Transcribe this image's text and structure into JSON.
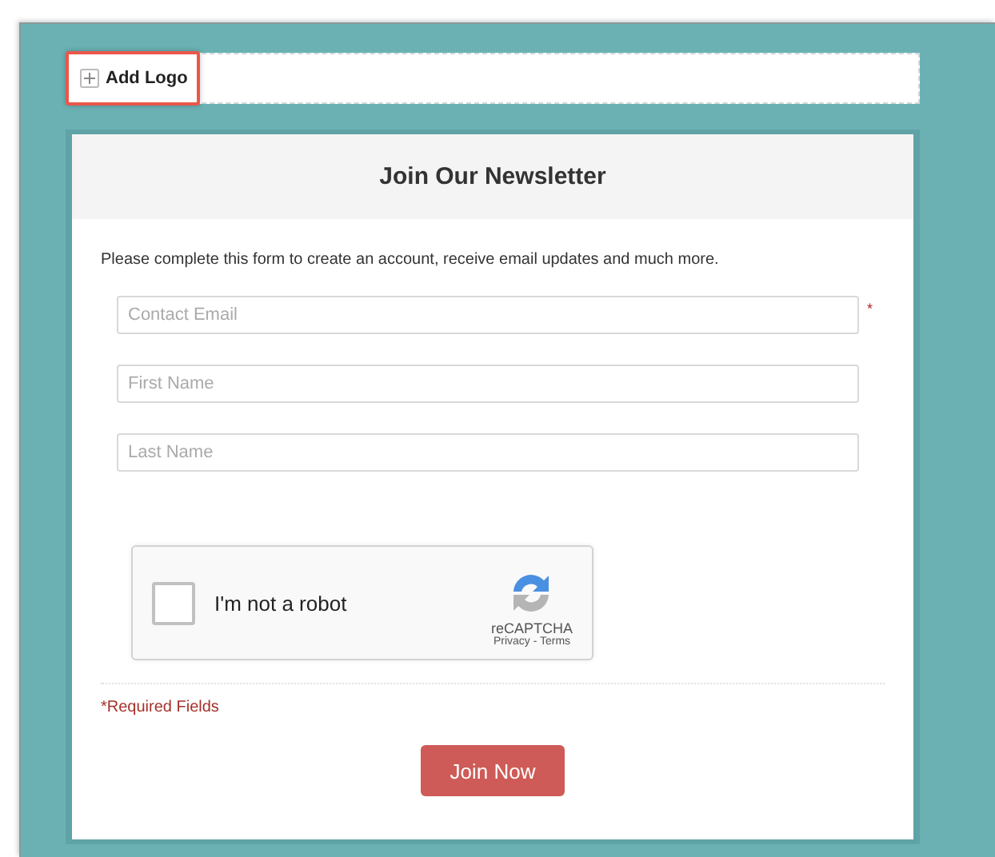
{
  "logo_bar": {
    "label": "Add Logo"
  },
  "form": {
    "title": "Join Our Newsletter",
    "intro": "Please complete this form to create an account, receive email updates and much more.",
    "fields": [
      {
        "placeholder": "Contact Email",
        "required_mark": "*"
      },
      {
        "placeholder": "First Name"
      },
      {
        "placeholder": "Last Name"
      }
    ],
    "captcha": {
      "label": "I'm not a robot",
      "checked": false,
      "brand": "reCAPTCHA",
      "links": "Privacy - Terms"
    },
    "required_note": "*Required Fields",
    "submit": "Join Now"
  }
}
